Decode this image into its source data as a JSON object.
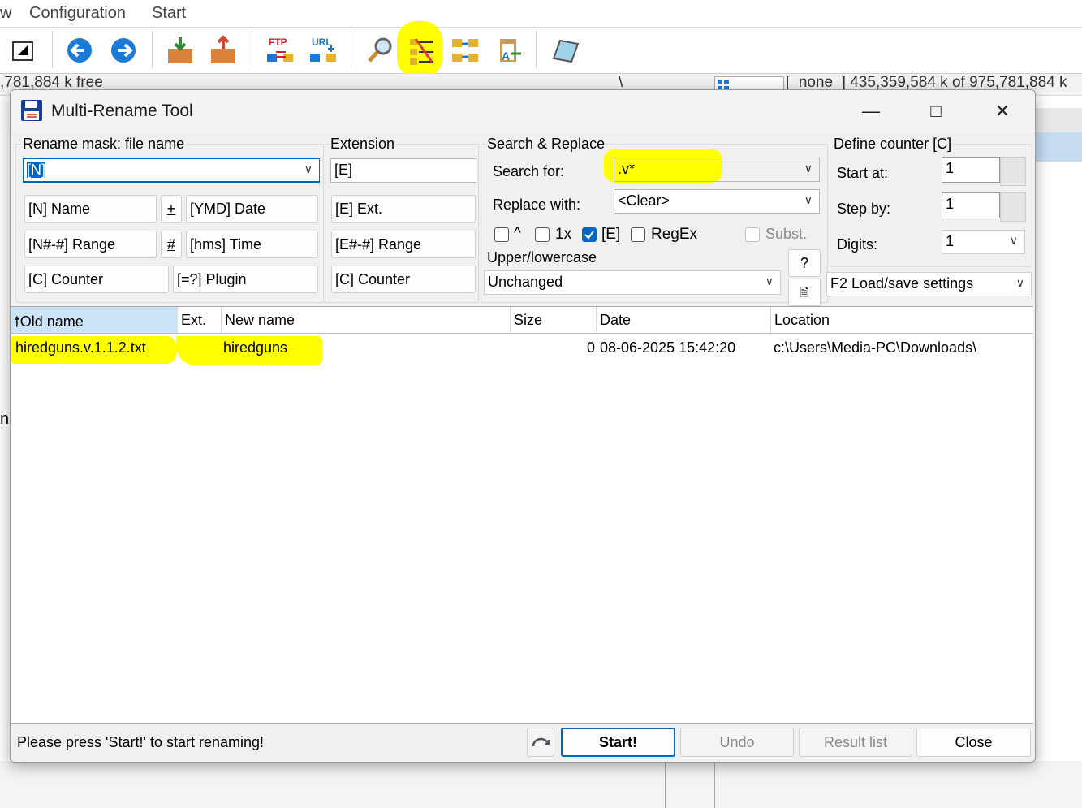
{
  "menu": {
    "partial_left": "w",
    "configuration": "Configuration",
    "start": "Start"
  },
  "toolbar": {
    "icons": [
      "brief-view-icon",
      "back-icon",
      "forward-icon",
      "pack-icon",
      "unpack-icon",
      "ftp-icon",
      "url-icon",
      "search-icon",
      "multi-rename-icon",
      "sync-dirs-icon",
      "copy-names-icon",
      "notepad-icon"
    ],
    "ftp_label": "FTP",
    "url_label": "URL"
  },
  "background": {
    "left_free": ",781,884 k free",
    "right_info": "[_none_]  435,359,584 k of 975,781,884 k",
    "sep": "\\",
    "side_char": "n"
  },
  "dialog": {
    "title": "Multi-Rename Tool",
    "rename_mask": {
      "label": "Rename mask: file name",
      "value": "[N]",
      "buttons": {
        "name": "[N]  Name",
        "plus": "+",
        "date": "[YMD]  Date",
        "range": "[N#-#] Range",
        "hash": "#",
        "time": "[hms]  Time",
        "counter": "[C]  Counter",
        "plugin": "[=?]  Plugin"
      }
    },
    "extension": {
      "label": "Extension",
      "value": "[E]",
      "buttons": {
        "ext": "[E]  Ext.",
        "range": "[E#-#] Range",
        "counter": "[C]  Counter"
      }
    },
    "search_replace": {
      "label": "Search & Replace",
      "search_label": "Search for:",
      "search_value": ".v*",
      "replace_label": "Replace with:",
      "replace_value": "<Clear>",
      "options": [
        {
          "label": "^",
          "checked": false,
          "disabled": false
        },
        {
          "label": "1x",
          "checked": false,
          "disabled": false
        },
        {
          "label": "[E]",
          "checked": true,
          "disabled": false
        },
        {
          "label": "RegEx",
          "checked": false,
          "disabled": false
        },
        {
          "label": "Subst.",
          "checked": false,
          "disabled": true
        }
      ],
      "case_label": "Upper/lowercase",
      "case_value": "Unchanged",
      "help": "?"
    },
    "counter": {
      "label": "Define counter [C]",
      "start_label": "Start at:",
      "start_value": "1",
      "step_label": "Step by:",
      "step_value": "1",
      "digits_label": "Digits:",
      "digits_value": "1",
      "load_save": "F2 Load/save settings"
    },
    "columns": [
      "Old name",
      "Ext.",
      "New name",
      "Size",
      "Date",
      "Location"
    ],
    "rows": [
      {
        "old_name": "hiredguns.v.1.1.2.txt",
        "ext": "",
        "new_name": "hiredguns",
        "size": "0",
        "date": "08-06-2025 15:42:20",
        "location": "c:\\Users\\Media-PC\\Downloads\\"
      }
    ],
    "status": "Please press 'Start!' to start renaming!",
    "buttons": {
      "start": "Start!",
      "undo": "Undo",
      "result_list": "Result list",
      "close": "Close"
    }
  },
  "colors": {
    "highlight": "#ffff00",
    "accent": "#0067c0",
    "selection": "#cce4f7"
  }
}
